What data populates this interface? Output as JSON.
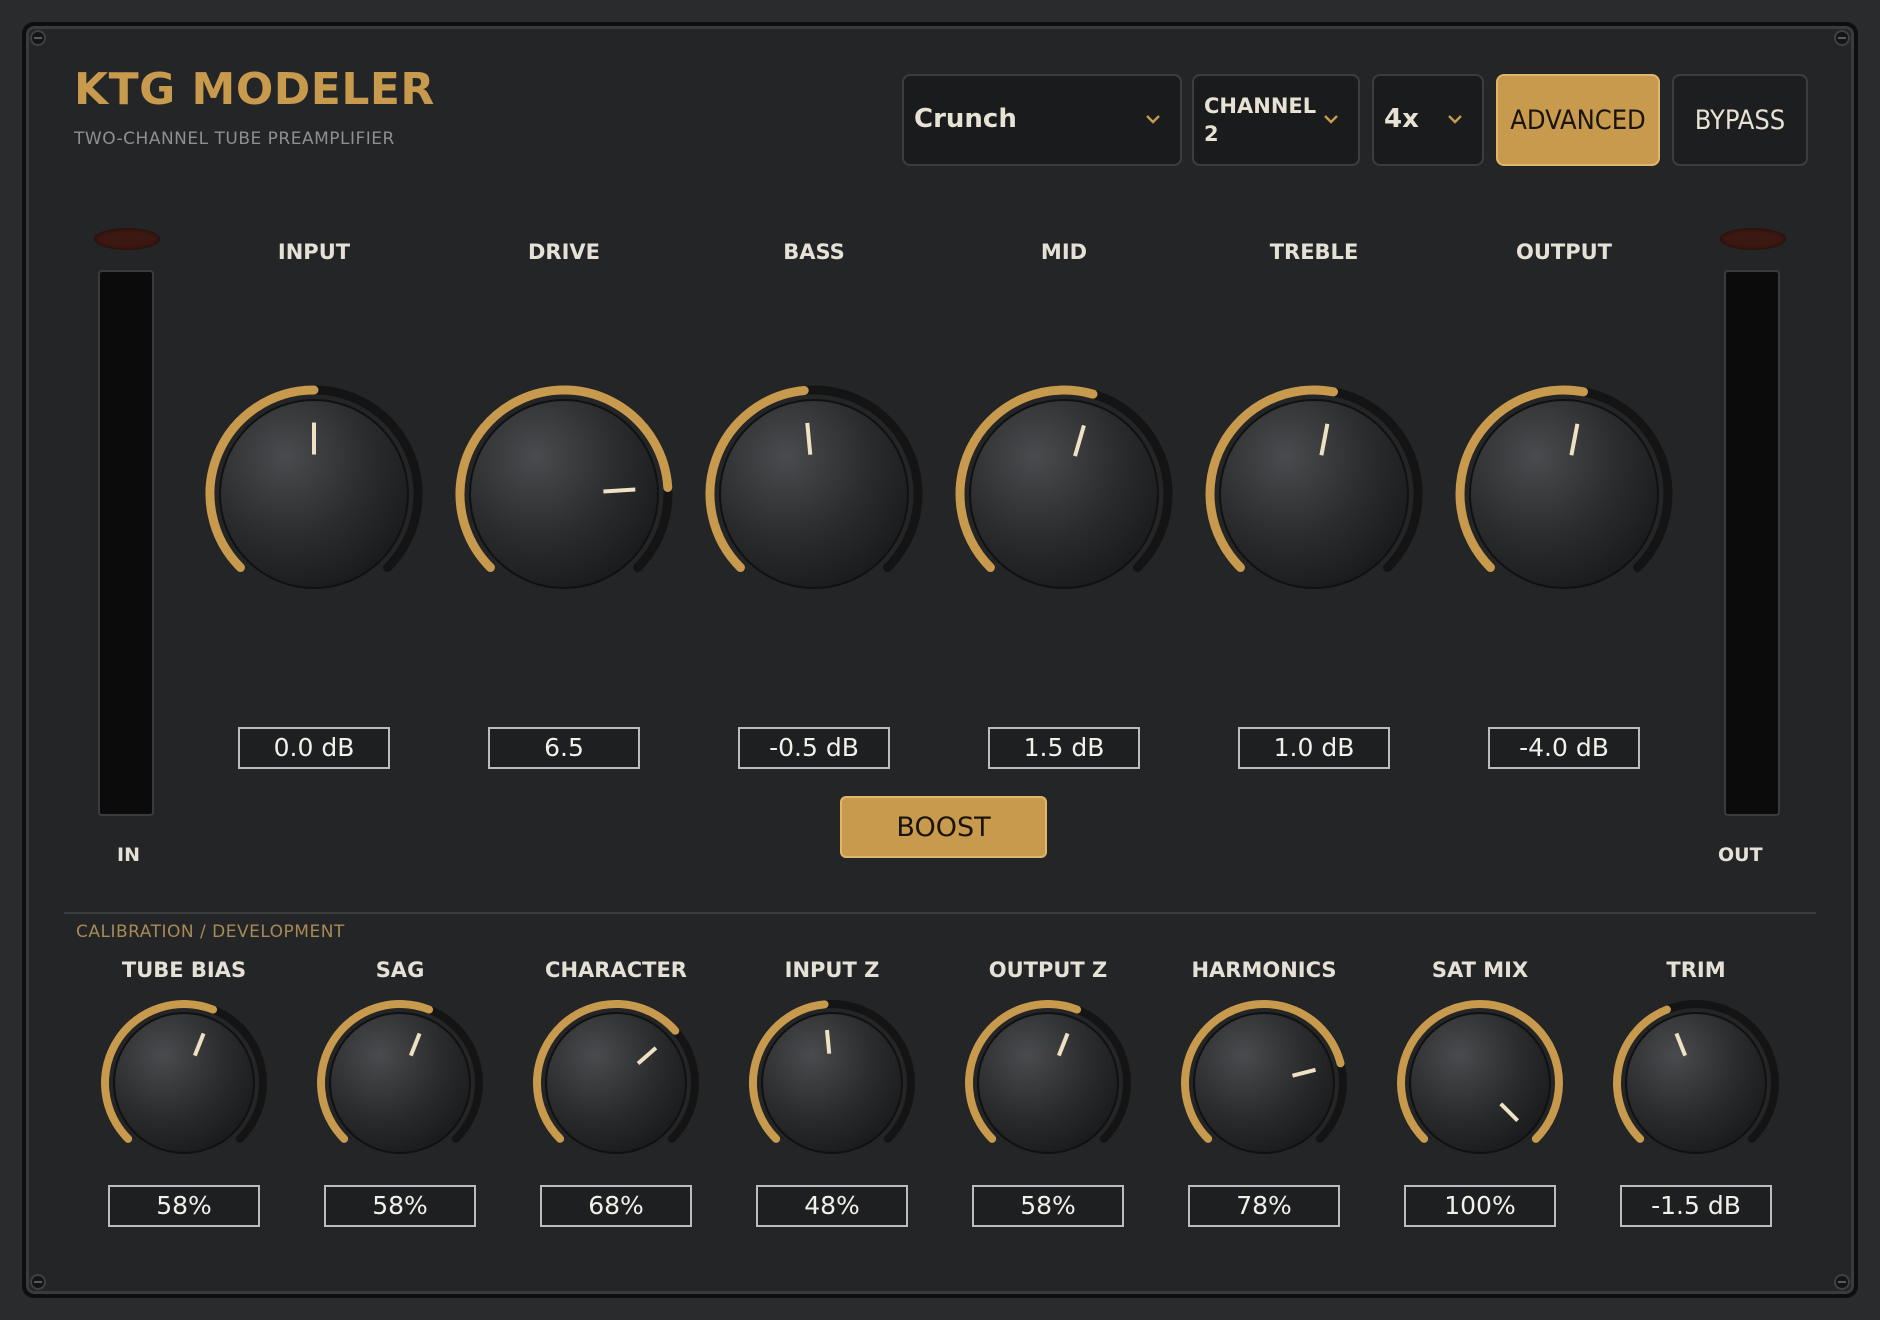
{
  "header": {
    "title": "KTG MODELER",
    "subtitle": "TWO-CHANNEL TUBE PREAMPLIFIER",
    "preset": "Crunch",
    "channel_line1": "CHANNEL",
    "channel_line2": "2",
    "oversampling": "4x",
    "advanced_label": "ADVANCED",
    "bypass_label": "BYPASS",
    "advanced_active": true
  },
  "meters": {
    "in_label": "IN",
    "out_label": "OUT"
  },
  "main_knobs": [
    {
      "label": "INPUT",
      "value": "0.0 dB",
      "position": 0.5
    },
    {
      "label": "DRIVE",
      "value": "6.5",
      "position": 0.82
    },
    {
      "label": "BASS",
      "value": "-0.5 dB",
      "position": 0.48
    },
    {
      "label": "MID",
      "value": "1.5 dB",
      "position": 0.56
    },
    {
      "label": "TREBLE",
      "value": "1.0 dB",
      "position": 0.54
    },
    {
      "label": "OUTPUT",
      "value": "-4.0 dB",
      "position": 0.54
    }
  ],
  "boost_label": "BOOST",
  "boost_active": true,
  "calibration": {
    "section_label": "CALIBRATION / DEVELOPMENT",
    "knobs": [
      {
        "label": "TUBE BIAS",
        "value": "58%",
        "position": 0.58
      },
      {
        "label": "SAG",
        "value": "58%",
        "position": 0.58
      },
      {
        "label": "CHARACTER",
        "value": "68%",
        "position": 0.68
      },
      {
        "label": "INPUT Z",
        "value": "48%",
        "position": 0.48
      },
      {
        "label": "OUTPUT Z",
        "value": "58%",
        "position": 0.58
      },
      {
        "label": "HARMONICS",
        "value": "78%",
        "position": 0.78
      },
      {
        "label": "SAT MIX",
        "value": "100%",
        "position": 1.0
      },
      {
        "label": "TRIM",
        "value": "-1.5 dB",
        "position": 0.42
      }
    ]
  },
  "colors": {
    "accent": "#c89a4e",
    "track": "#141414",
    "panel": "#242527"
  }
}
